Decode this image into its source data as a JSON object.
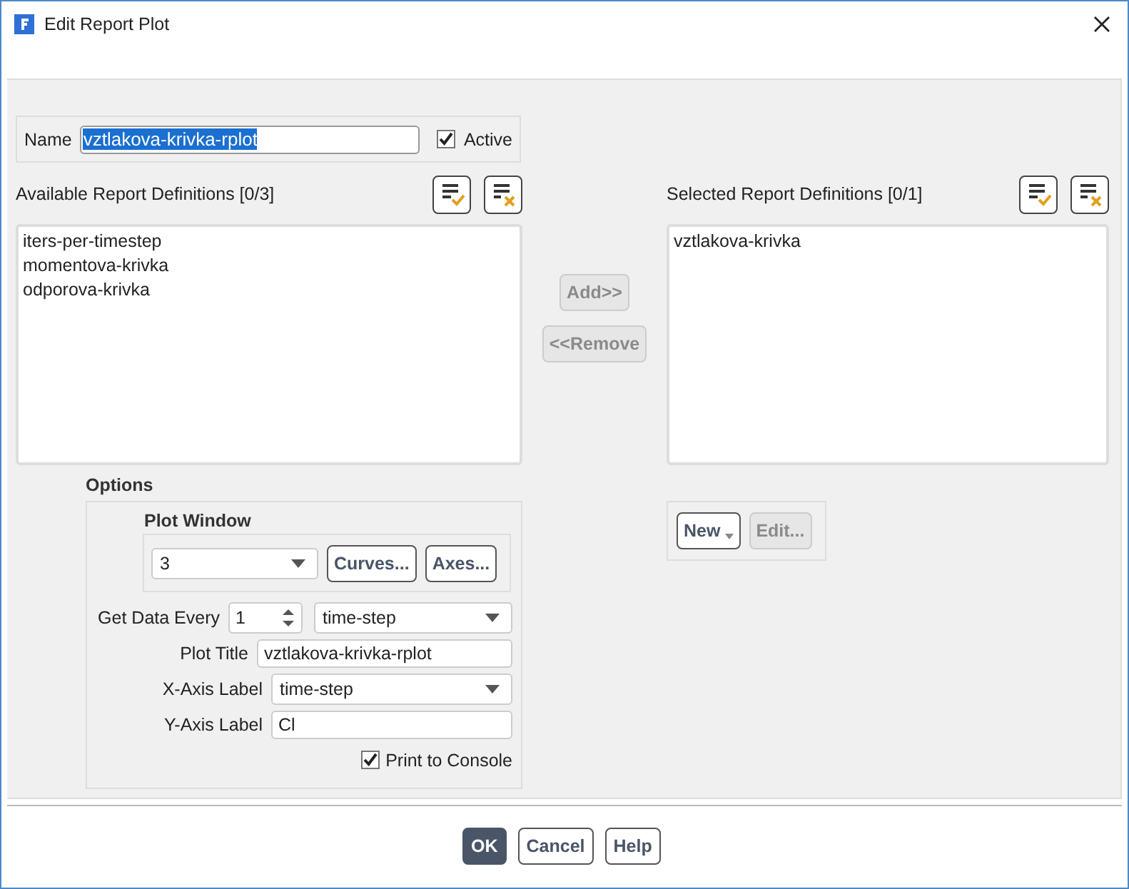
{
  "window": {
    "title": "Edit Report Plot"
  },
  "name_field": {
    "label": "Name",
    "value": "vztlakova-krivka-rplot",
    "text_selected": true
  },
  "active": {
    "label": "Active",
    "checked": true
  },
  "available": {
    "title": "Available Report Definitions [0/3]",
    "items": [
      {
        "label": "iters-per-timestep",
        "selected": false
      },
      {
        "label": "momentova-krivka",
        "selected": false
      },
      {
        "label": "odporova-krivka",
        "selected": false
      }
    ]
  },
  "transfer_buttons": [
    {
      "label": "Add>>",
      "disabled": true
    },
    {
      "label": "<<Remove",
      "disabled": true
    }
  ],
  "selected": {
    "title": "Selected Report Definitions [0/1]",
    "items": [
      {
        "label": "vztlakova-krivka",
        "selected": false
      }
    ]
  },
  "definition_buttons": [
    {
      "label": "New",
      "kind": "menu",
      "disabled": false
    },
    {
      "label": "Edit...",
      "kind": "plain",
      "disabled": true
    }
  ],
  "options": {
    "title": "Options",
    "plot_window": {
      "title": "Plot Window",
      "value": "3",
      "buttons": [
        "Curves...",
        "Axes..."
      ]
    },
    "get_data_every": {
      "label": "Get Data Every",
      "value": "1",
      "unit": "time-step"
    },
    "plot_title": {
      "label": "Plot Title",
      "value": "vztlakova-krivka-rplot"
    },
    "x_axis_label": {
      "label": "X-Axis Label",
      "value": "time-step"
    },
    "y_axis_label": {
      "label": "Y-Axis Label",
      "value": "Cl"
    },
    "print_to_console": {
      "label": "Print to Console",
      "checked": true
    }
  },
  "footer_buttons": [
    {
      "label": "OK",
      "kind": "primary"
    },
    {
      "label": "Cancel",
      "kind": "default"
    },
    {
      "label": "Help",
      "kind": "default"
    }
  ]
}
